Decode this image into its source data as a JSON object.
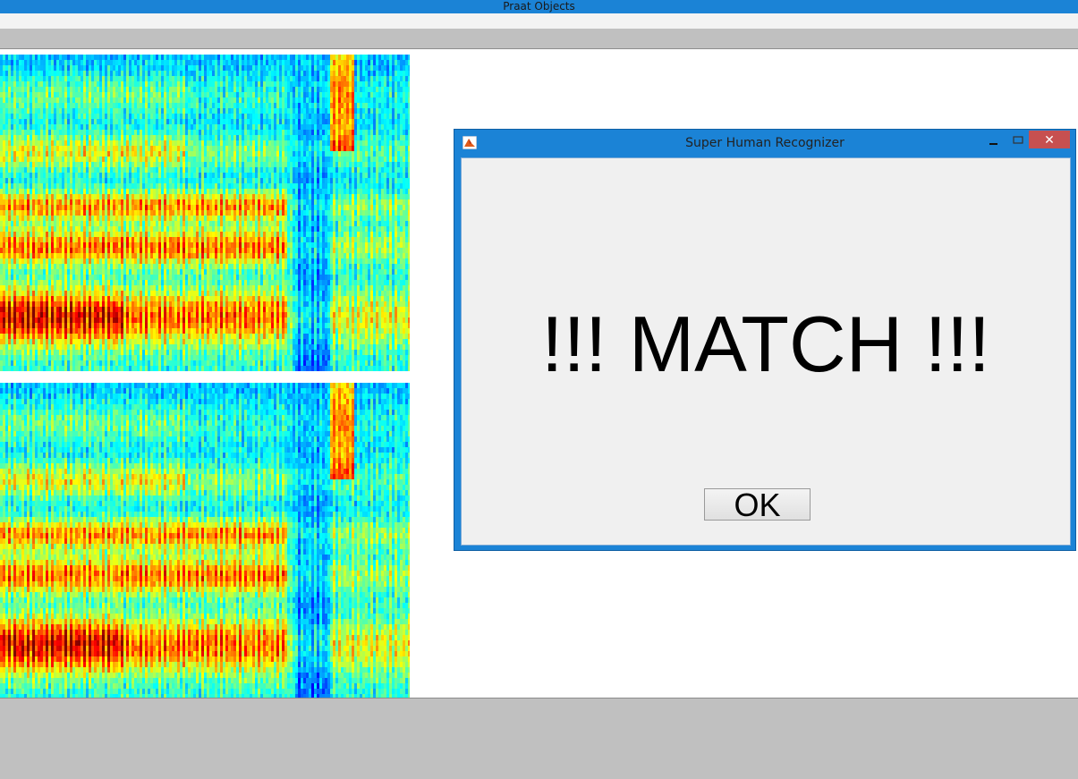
{
  "window": {
    "title": "Praat Objects"
  },
  "dialog": {
    "title": "Super Human Recognizer",
    "message": "!!! MATCH !!!",
    "ok_label": "OK",
    "close_glyph": "✕",
    "app_icon": "matlab-icon"
  },
  "spectrograms": [
    {
      "name": "spectrogram-top"
    },
    {
      "name": "spectrogram-bottom"
    }
  ],
  "colors": {
    "titlebar": "#1b83d6",
    "dialog_frame": "#1b83d6",
    "close_button": "#c75050",
    "panel_gray": "#c0c0c0"
  }
}
